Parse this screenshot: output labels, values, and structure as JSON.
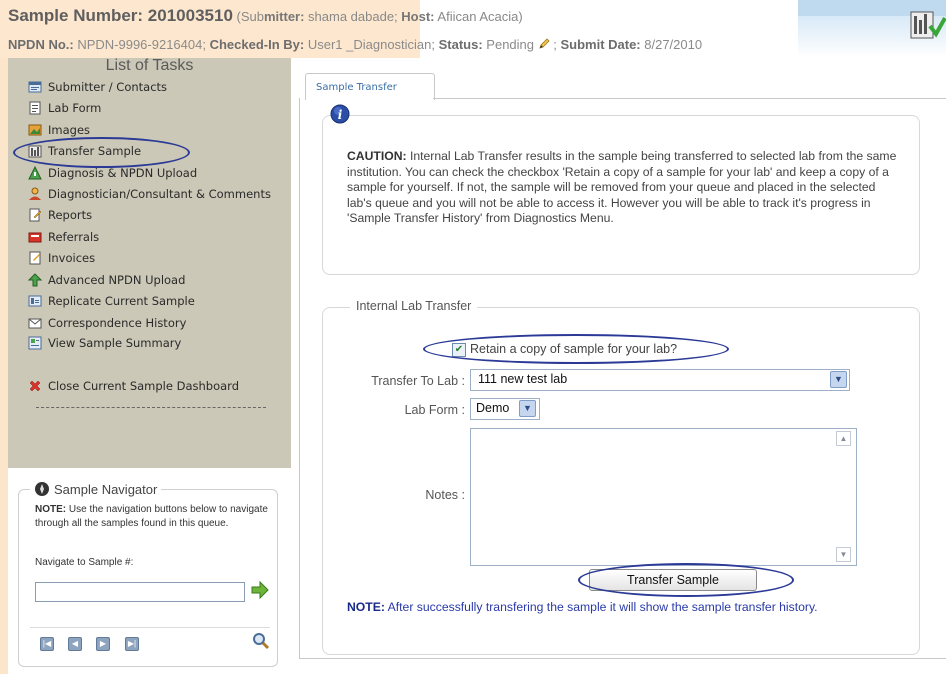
{
  "header": {
    "sample_label": "Sample Number: 201003510",
    "submitter_prefix": " (Sub",
    "submitter_key": "mitter:",
    "submitter_value": " shama dabade; ",
    "host_key": "Host:",
    "host_value": " Afiican Acacia)",
    "npdn_key": "NPDN No.:",
    "npdn_value": " NPDN-9996-9216404; ",
    "checked_key": "Checked-In By:",
    "checked_value": " User1 _Diagnostician; ",
    "status_key": "Status:",
    "status_value": " Pending ",
    "submit_sep": " ; ",
    "submit_key": "Submit Date:",
    "submit_value": " 8/27/2010"
  },
  "sidebar": {
    "title": "List of Tasks",
    "items": [
      {
        "label": "Submitter / Contacts",
        "icon": "contacts-icon"
      },
      {
        "label": "Lab Form",
        "icon": "form-icon"
      },
      {
        "label": "Images",
        "icon": "images-icon"
      },
      {
        "label": "Transfer Sample",
        "icon": "transfer-icon"
      },
      {
        "label": "Diagnosis & NPDN Upload",
        "icon": "diagnosis-icon"
      },
      {
        "label": "Diagnostician/Consultant & Comments",
        "icon": "consultant-icon"
      },
      {
        "label": "Reports",
        "icon": "reports-icon"
      },
      {
        "label": "Referrals",
        "icon": "referrals-icon"
      },
      {
        "label": "Invoices",
        "icon": "invoices-icon"
      },
      {
        "label": "Advanced NPDN Upload",
        "icon": "upload-arrow-icon"
      },
      {
        "label": "Replicate Current Sample",
        "icon": "replicate-icon"
      },
      {
        "label": "Correspondence History",
        "icon": "mail-icon"
      },
      {
        "label": "View Sample Summary",
        "icon": "summary-icon"
      }
    ],
    "close_label": "Close Current Sample Dashboard"
  },
  "navigator": {
    "title": "Sample Navigator",
    "note_key": "NOTE:",
    "note_text": " Use the navigation buttons below to navigate through all the samples found in this queue.",
    "input_label": "Navigate to Sample #:",
    "input_value": ""
  },
  "main": {
    "tab_label": "Sample Transfer",
    "caution_key": "CAUTION:",
    "caution_text": " Internal Lab Transfer results in the sample being transferred to selected lab from the same institution. You can check the checkbox 'Retain a copy of a sample for your lab' and keep a copy of a sample for yourself. If not, the sample will be removed from your queue and placed in the selected lab's queue and you will not be able to access it. However you will be able to track it's progress in 'Sample Transfer History' from Diagnostics Menu.",
    "section_title": "Internal Lab Transfer",
    "retain_label": "Retain a copy of sample for your lab?",
    "retain_checked": true,
    "transfer_to_label": "Transfer To Lab :",
    "transfer_to_value": "111 new test lab",
    "lab_form_label": "Lab Form :",
    "lab_form_value": "Demo",
    "notes_label": "Notes :",
    "notes_value": "",
    "button_label": "Transfer Sample",
    "bottom_note_key": "NOTE:",
    "bottom_note_text": " After successfully transfering the sample it will show the sample transfer history."
  },
  "colors": {
    "header_bg": "#fde8cf",
    "sidebar_bg": "#cbc8b7",
    "annotation_oval": "#2b3a96",
    "note_text": "#2a3aa8"
  }
}
